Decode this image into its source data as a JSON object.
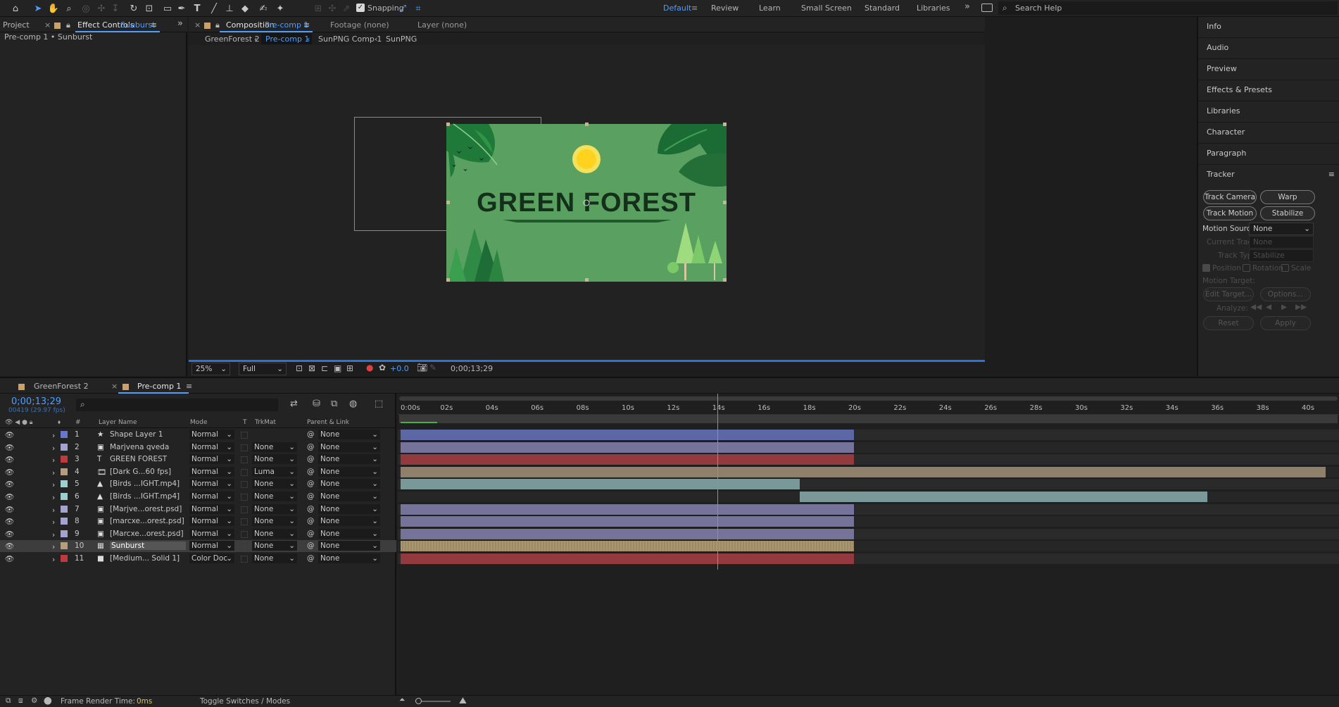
{
  "toolbar": {
    "snapping_label": "Snapping",
    "workspaces": [
      "Default",
      "Review",
      "Learn",
      "Small Screen",
      "Standard",
      "Libraries"
    ],
    "active_workspace": "Default",
    "search_placeholder": "Search Help"
  },
  "left_panel": {
    "tab_project": "Project",
    "tab_effect_controls": "Effect Controls",
    "effect_layer": "Sunburst",
    "breadcrumb": "Pre-comp 1 • Sunburst"
  },
  "comp_panel": {
    "tab_composition": "Composition",
    "comp_name": "Pre-comp 1",
    "tab_footage": "Footage (none)",
    "tab_layer": "Layer (none)",
    "breadcrumbs": [
      "GreenForest 2",
      "Pre-comp 1",
      "SunPNG Comp 1",
      "SunPNG"
    ],
    "active_crumb": "Pre-comp 1",
    "artwork_title": "GREEN FOREST",
    "zoom": "25%",
    "resolution": "Full",
    "exposure": "+0.0",
    "timecode": "0;00;13;29"
  },
  "right_panel": {
    "items": [
      "Info",
      "Audio",
      "Preview",
      "Effects & Presets",
      "Libraries",
      "Character",
      "Paragraph"
    ],
    "tracker": {
      "title": "Tracker",
      "buttons": [
        "Track Camera",
        "Warp Stabilizer",
        "Track Motion",
        "Stabilize Motion"
      ],
      "motion_source_label": "Motion Source:",
      "motion_source_value": "None",
      "current_track_label": "Current Track:",
      "current_track_value": "None",
      "track_type_label": "Track Type:",
      "track_type_value": "Stabilize",
      "checks": [
        "Position",
        "Rotation",
        "Scale"
      ],
      "motion_target_label": "Motion Target:",
      "edit_target": "Edit Target...",
      "options": "Options...",
      "analyze_label": "Analyze:",
      "reset": "Reset",
      "apply": "Apply"
    }
  },
  "timeline": {
    "tabs": [
      "GreenForest 2",
      "Pre-comp 1"
    ],
    "active_tab": "Pre-comp 1",
    "timecode": "0;00;13;29",
    "frame_info": "00419 (29.97 fps)",
    "columns": {
      "num": "#",
      "layer_name": "Layer Name",
      "mode": "Mode",
      "t": "T",
      "trkmat": "TrkMat",
      "parent": "Parent & Link"
    },
    "ruler": [
      "0:00s",
      "02s",
      "04s",
      "06s",
      "08s",
      "10s",
      "12s",
      "14s",
      "16s",
      "18s",
      "20s",
      "22s",
      "24s",
      "26s",
      "28s",
      "30s",
      "32s",
      "34s",
      "36s",
      "38s",
      "40s"
    ],
    "playhead_time_s": 13.97,
    "layers": [
      {
        "num": "1",
        "name": "Shape Layer 1",
        "mode": "Normal",
        "trkmat": "",
        "parent": "None",
        "color": "#6677cc",
        "icon": "star-icon",
        "bar_start_s": 0,
        "bar_end_s": 20,
        "bar_color": "#5c67a6"
      },
      {
        "num": "2",
        "name": "Marjvena qveda",
        "mode": "Normal",
        "trkmat": "None",
        "parent": "None",
        "color": "#a3a3cf",
        "icon": "file-icon",
        "bar_start_s": 0,
        "bar_end_s": 20,
        "bar_color": "#76739a"
      },
      {
        "num": "3",
        "name": "GREEN FOREST",
        "mode": "Normal",
        "trkmat": "None",
        "parent": "None",
        "color": "#c0393c",
        "icon": "text-icon",
        "bar_start_s": 0,
        "bar_end_s": 20,
        "bar_color": "#923a3d"
      },
      {
        "num": "4",
        "name": "[Dark G...60 fps]",
        "mode": "Normal",
        "trkmat": "Luma",
        "parent": "None",
        "color": "#b59e7d",
        "icon": "film-icon",
        "bar_start_s": 0,
        "bar_end_s": 40.8,
        "bar_color": "#8e806a"
      },
      {
        "num": "5",
        "name": "[Birds ...IGHT.mp4]",
        "mode": "Normal",
        "trkmat": "None",
        "parent": "None",
        "color": "#9ccfcf",
        "icon": "cone-icon",
        "bar_start_s": 0,
        "bar_end_s": 17.6,
        "bar_color": "#7b9898"
      },
      {
        "num": "6",
        "name": "[Birds ...IGHT.mp4]",
        "mode": "Normal",
        "trkmat": "None",
        "parent": "None",
        "color": "#9ccfcf",
        "icon": "cone-icon",
        "bar_start_s": 17.6,
        "bar_end_s": 35.6,
        "bar_color": "#7b9898"
      },
      {
        "num": "7",
        "name": "[Marjve...orest.psd]",
        "mode": "Normal",
        "trkmat": "None",
        "parent": "None",
        "color": "#a3a3cf",
        "icon": "file-icon",
        "bar_start_s": 0,
        "bar_end_s": 20,
        "bar_color": "#76739a"
      },
      {
        "num": "8",
        "name": "[marcxe...orest.psd]",
        "mode": "Normal",
        "trkmat": "None",
        "parent": "None",
        "color": "#a3a3cf",
        "icon": "file-icon",
        "bar_start_s": 0,
        "bar_end_s": 20,
        "bar_color": "#76739a"
      },
      {
        "num": "9",
        "name": "[Marcxe...orest.psd]",
        "mode": "Normal",
        "trkmat": "None",
        "parent": "None",
        "color": "#a3a3cf",
        "icon": "file-icon",
        "bar_start_s": 0,
        "bar_end_s": 20,
        "bar_color": "#76739a"
      },
      {
        "num": "10",
        "name": "Sunburst",
        "mode": "Normal",
        "trkmat": "None",
        "parent": "None",
        "color": "#b59e7d",
        "icon": "comp-icon",
        "bar_start_s": 0,
        "bar_end_s": 20,
        "bar_color": "#9d8c6a",
        "selected": true
      },
      {
        "num": "11",
        "name": "[Medium... Solid 1]",
        "mode": "Color Doc",
        "trkmat": "None",
        "parent": "None",
        "color": "#c0393c",
        "icon": "solid-icon",
        "bar_start_s": 0,
        "bar_end_s": 20,
        "bar_color": "#923a3d"
      }
    ],
    "footer": {
      "render_label": "Frame Render Time:",
      "render_value": "0ms",
      "toggle": "Toggle Switches / Modes"
    }
  }
}
